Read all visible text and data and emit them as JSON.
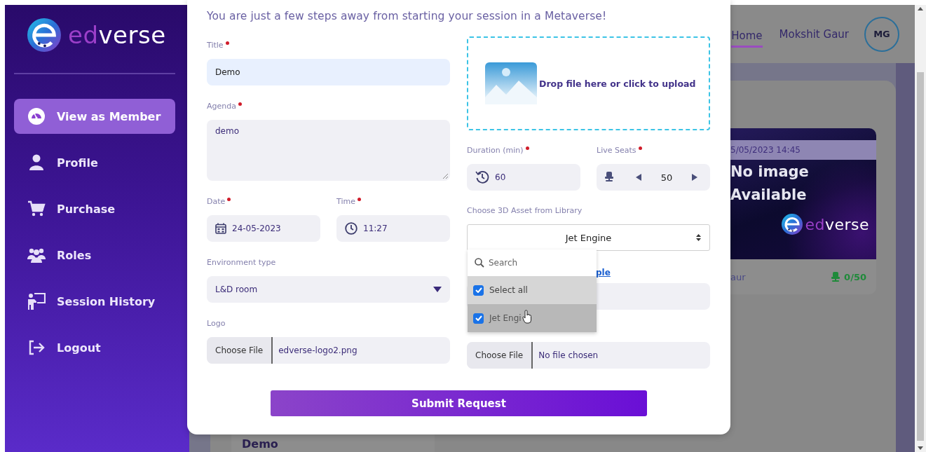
{
  "sidebar": {
    "logo": {
      "accent": "ed",
      "rest": "verse"
    },
    "items": [
      {
        "label": "View as Member",
        "selected": true
      },
      {
        "label": "Profile",
        "selected": false
      },
      {
        "label": "Purchase",
        "selected": false
      },
      {
        "label": "Roles",
        "selected": false
      },
      {
        "label": "Session History",
        "selected": false
      },
      {
        "label": "Logout",
        "selected": false
      }
    ]
  },
  "header": {
    "nav": [
      {
        "label": "Home",
        "selected": true
      }
    ],
    "user_name": "Mokshit Gaur",
    "avatar_initials": "MG"
  },
  "session_card": {
    "date": "5/05/2023 14:45",
    "banner_text": "No image Available",
    "logo": {
      "accent": "ed",
      "rest": "verse"
    },
    "host": "aur",
    "seats": "0/50"
  },
  "next_session_card": {
    "title": "Demo"
  },
  "form": {
    "subtitle": "You are just a few steps away from starting your session in a Metaverse!",
    "title_field": {
      "label": "Title",
      "required": true,
      "value": "Demo"
    },
    "agenda_field": {
      "label": "Agenda",
      "required": true,
      "value": "demo"
    },
    "date_field": {
      "label": "Date",
      "required": true,
      "value": "24-05-2023"
    },
    "time_field": {
      "label": "Time",
      "required": true,
      "value": "11:27"
    },
    "environment_field": {
      "label": "Environment type",
      "required": false,
      "value": "L&D room"
    },
    "logo_field": {
      "label": "Logo",
      "button": "Choose File",
      "file_name": "edverse-logo2.png"
    },
    "upload_area": {
      "text": "Drop file here or click to upload"
    },
    "duration_field": {
      "label": "Duration (min)",
      "required": true,
      "value": "60"
    },
    "seats_field": {
      "label": "Live Seats",
      "required": true,
      "value": "50"
    },
    "asset_field": {
      "label": "Choose 3D Asset from Library",
      "value": "Jet Engine",
      "expanded": true,
      "dropdown": {
        "search_placeholder": "Search",
        "options": [
          {
            "label": "Select all",
            "checked": true,
            "hovered": false
          },
          {
            "label": "Jet Engi",
            "checked": true,
            "hovered": true
          }
        ]
      }
    },
    "sample_link": "ple",
    "file_field": {
      "button": "Choose File",
      "file_name": "No file chosen"
    },
    "submit_button": "Submit Request"
  }
}
